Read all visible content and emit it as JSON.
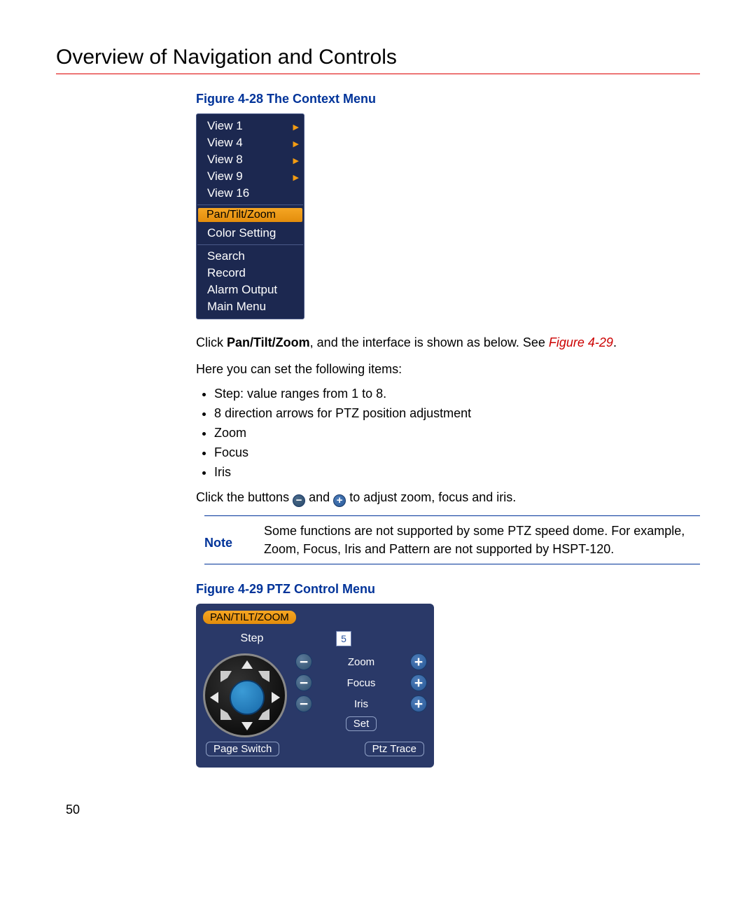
{
  "page": {
    "title": "Overview of Navigation and Controls",
    "number": "50"
  },
  "figure28": {
    "caption": "Figure 4-28 The Context Menu",
    "menu": {
      "items_top": [
        "View 1",
        "View 4",
        "View 8",
        "View 9",
        "View 16"
      ],
      "items_top_has_arrow": [
        true,
        true,
        true,
        true,
        false
      ],
      "selected": "Pan/Tilt/Zoom",
      "item_below_selected": "Color Setting",
      "items_bottom": [
        "Search",
        "Record",
        "Alarm Output",
        "Main Menu"
      ]
    }
  },
  "body": {
    "click_intro_1": "Click ",
    "click_intro_bold": "Pan/Tilt/Zoom",
    "click_intro_2": ", and the interface is shown as below. See ",
    "click_intro_link": "Figure 4-29",
    "click_intro_3": ".",
    "set_intro": "Here you can set the following items:",
    "bullets": [
      "Step: value ranges from 1 to 8.",
      "8 direction arrows for PTZ position adjustment",
      "Zoom",
      "Focus",
      "Iris"
    ],
    "click_buttons_1": "Click the buttons",
    "click_buttons_2": "and",
    "click_buttons_3": "to adjust zoom, focus and iris."
  },
  "note": {
    "label": "Note",
    "text": "Some functions are not supported by some PTZ speed dome. For example, Zoom, Focus, Iris and Pattern are not supported by HSPT-120."
  },
  "figure29": {
    "caption": "Figure 4-29 PTZ Control Menu",
    "panel": {
      "title": "PAN/TILT/ZOOM",
      "step_label": "Step",
      "step_value": "5",
      "rows": [
        {
          "label": "Zoom"
        },
        {
          "label": "Focus"
        },
        {
          "label": "Iris"
        }
      ],
      "set": "Set",
      "page_switch": "Page Switch",
      "ptz_trace": "Ptz Trace"
    }
  }
}
